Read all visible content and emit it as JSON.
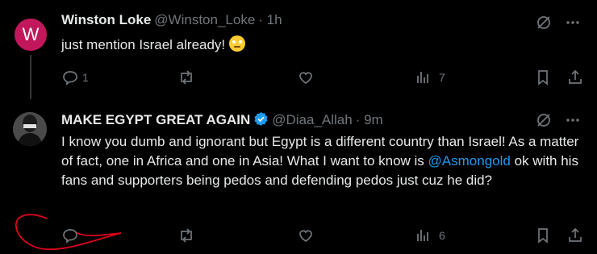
{
  "tweet1": {
    "avatar_letter": "W",
    "display_name": "Winston Loke",
    "handle": "@Winston_Loke",
    "time": "· 1h",
    "text": "just mention Israel already!",
    "emoji": "face-with-rolling-eyes",
    "reply_count": "1",
    "retweet_count": "",
    "like_count": "",
    "view_count": "7"
  },
  "tweet2": {
    "display_name": "MAKE EGYPT GREAT AGAIN",
    "handle": "@Diaa_Allah",
    "time": "· 9m",
    "text_part1": "I know you dumb and ignorant but Egypt is a different country than Israel! As a matter of fact, one in Africa and one in Asia! What I want to know is",
    "mention": "@Asmongold",
    "text_part2": "ok with his fans and supporters being pedos and defending pedos just cuz he did?",
    "reply_count": "",
    "retweet_count": "",
    "like_count": "",
    "view_count": "6"
  },
  "colors": {
    "background": "#000000",
    "text": "#e7e9ea",
    "muted": "#71767b",
    "link": "#1d9bf0",
    "verified": "#1d9bf0",
    "annotation": "#e0001b"
  }
}
